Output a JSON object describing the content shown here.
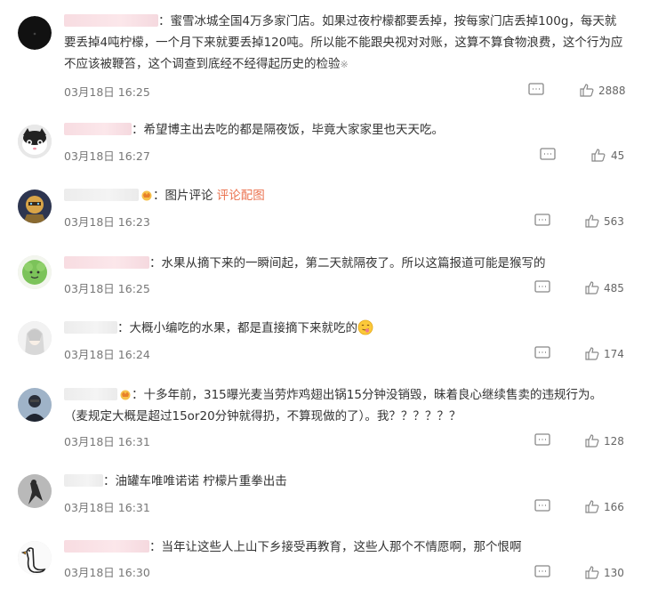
{
  "comments": [
    {
      "text_line1": "蜜雪冰城全国4万多家门店。如果过夜柠檬都要丢掉，按每家门店丢掉100g，每天就",
      "text_line2": "要丢掉4吨柠檬，一个月下来就要丢掉120吨。所以能不能跟央视对对账，这算不算食物浪费，这个行为应",
      "text_line3": "不应该被鞭笞，这个调查到底经不经得起历史的检验",
      "time": "03月18日 16:25",
      "likes": "2888"
    },
    {
      "text": "希望博主出去吃的都是隔夜饭，毕竟大家家里也天天吃。",
      "time": "03月18日 16:27",
      "likes": "45"
    },
    {
      "text": "图片评论",
      "link": "评论配图",
      "time": "03月18日 16:23",
      "likes": "563"
    },
    {
      "text": "水果从摘下来的一瞬间起，第二天就隔夜了。所以这篇报道可能是猴写的",
      "time": "03月18日 16:25",
      "likes": "485"
    },
    {
      "text": "大概小编吃的水果，都是直接摘下来就吃的",
      "time": "03月18日 16:24",
      "likes": "174"
    },
    {
      "text_line1": "十多年前，315曝光麦当劳炸鸡翅出锅15分钟没销毁，昧着良心继续售卖的违规行为。",
      "text_line2": "（麦规定大概是超过15or20分钟就得扔，不算现做的了）。我？？？？？？",
      "time": "03月18日 16:31",
      "likes": "128"
    },
    {
      "text": "油罐车唯唯诺诺 柠檬片重拳出击",
      "time": "03月18日 16:31",
      "likes": "166"
    },
    {
      "text": "当年让这些人上山下乡接受再教育，这些人那个不情愿啊，那个恨啊",
      "time": "03月18日 16:30",
      "likes": "130"
    }
  ],
  "icons": {
    "reply": "comment-icon",
    "like": "thumbs-up-icon",
    "crown": "vip-crown-icon",
    "emoji": "tongue-emoji-icon"
  },
  "colors": {
    "link": "#eb7350",
    "text": "#333333",
    "meta": "#777777"
  }
}
